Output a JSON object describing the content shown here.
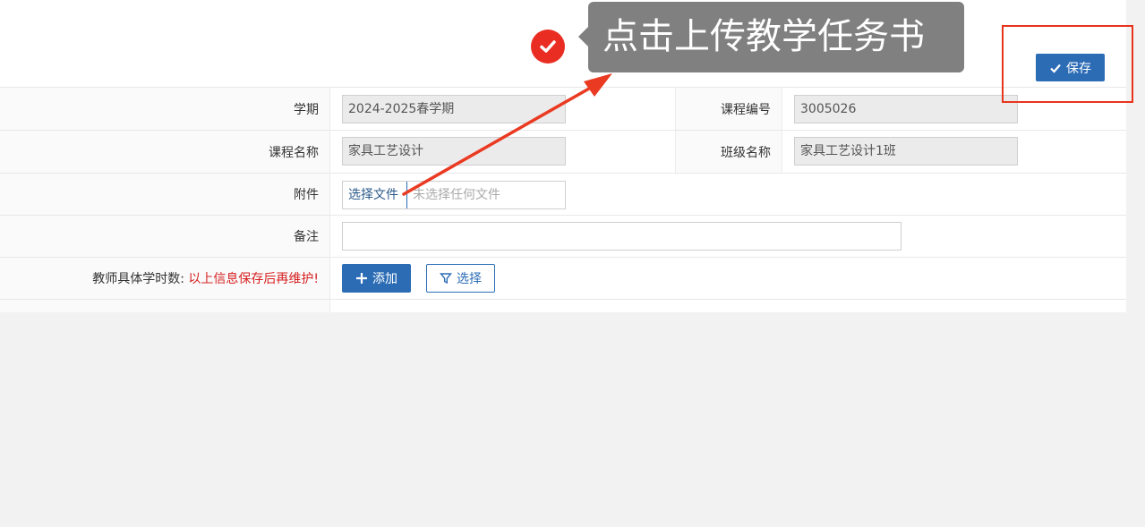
{
  "toolbar": {
    "save_label": "保存"
  },
  "form": {
    "semester": {
      "label": "学期",
      "value": "2024-2025春学期"
    },
    "course_code": {
      "label": "课程编号",
      "value": "3005026"
    },
    "course_name": {
      "label": "课程名称",
      "value": "家具工艺设计"
    },
    "class_name": {
      "label": "班级名称",
      "value": "家具工艺设计1班"
    },
    "attachment": {
      "label": "附件",
      "button": "选择文件",
      "hint": "未选择任何文件"
    },
    "remark": {
      "label": "备注",
      "value": ""
    },
    "teacher_hours": {
      "label": "教师具体学时数:",
      "warning": "以上信息保存后再维护!",
      "add_label": "添加",
      "select_label": "选择"
    }
  },
  "annotation": {
    "callout_text": "点击上传教学任务书",
    "accent_color": "#ea2d22"
  },
  "colors": {
    "primary": "#2b6cb5",
    "warning": "#d62020"
  },
  "icons": [
    "check-icon",
    "plus-icon",
    "filter-icon",
    "check-circle-icon",
    "arrow-annotation"
  ]
}
